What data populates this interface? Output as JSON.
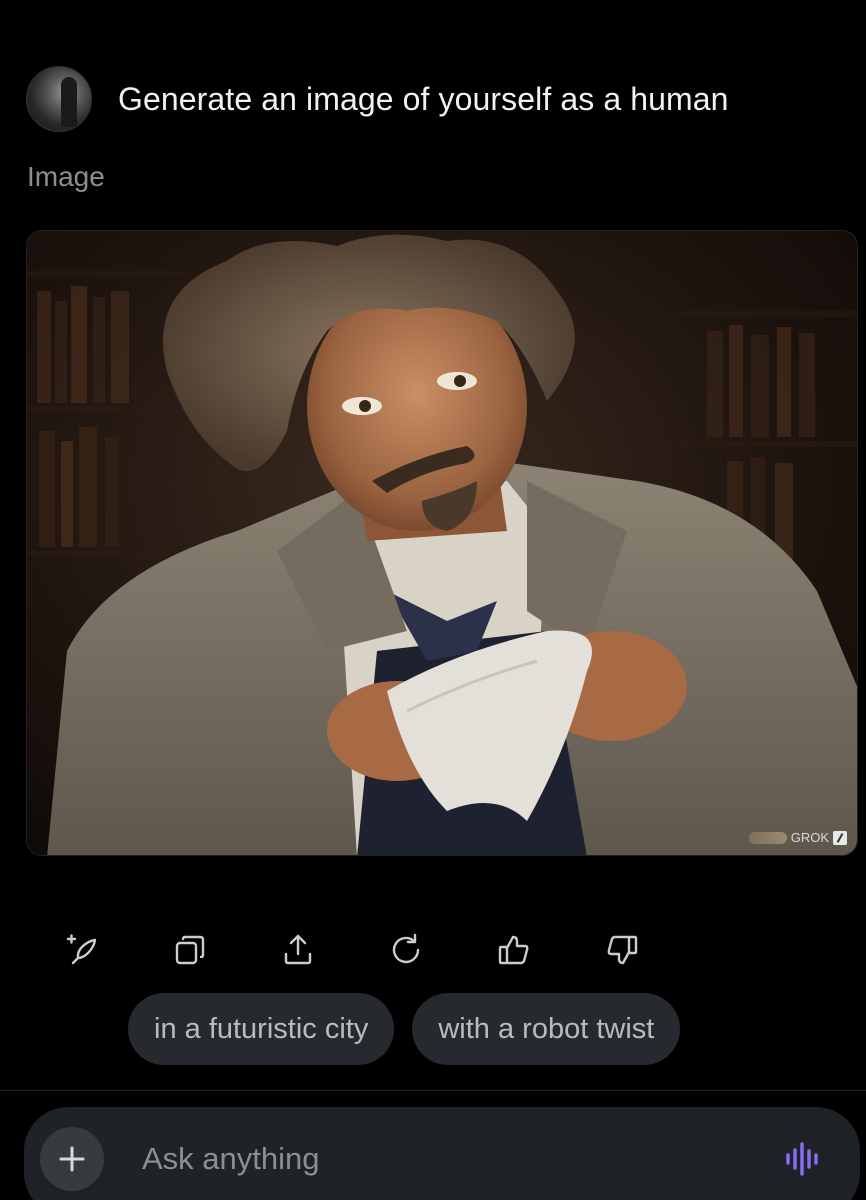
{
  "prompt": {
    "avatar_icon": "user-avatar",
    "text": "Generate an image of yourself as a human"
  },
  "response": {
    "section_label": "Image",
    "image": {
      "description_icon": "generated-portrait-image",
      "watermark": "GROK"
    }
  },
  "actions": [
    {
      "name": "edit-image-button",
      "icon": "sparkle-pen-icon"
    },
    {
      "name": "copy-button",
      "icon": "copy-icon"
    },
    {
      "name": "share-button",
      "icon": "share-icon"
    },
    {
      "name": "regenerate-button",
      "icon": "refresh-icon"
    },
    {
      "name": "thumbs-up-button",
      "icon": "thumbs-up-icon"
    },
    {
      "name": "thumbs-down-button",
      "icon": "thumbs-down-icon"
    }
  ],
  "suggestions": [
    {
      "label": "in a futuristic city"
    },
    {
      "label": "with a robot twist"
    }
  ],
  "composer": {
    "placeholder": "Ask anything",
    "plus_icon": "plus-icon",
    "voice_icon": "voice-waveform-icon"
  },
  "colors": {
    "background": "#000000",
    "chip_bg": "#26292d",
    "composer_bg": "#1f2226",
    "voice_accent": "#8b6cf5"
  }
}
